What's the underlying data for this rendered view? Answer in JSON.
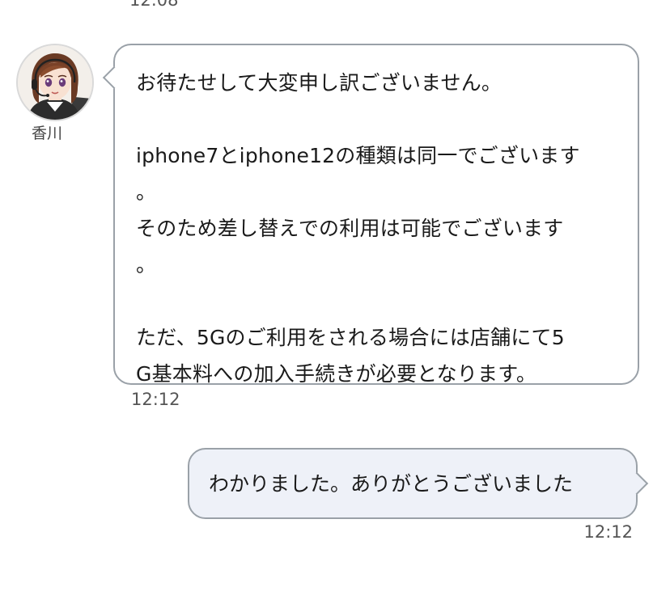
{
  "chat": {
    "top_timestamp": "12:08",
    "agent": {
      "name": "香川",
      "avatar_icon": "agent-avatar-icon",
      "message_lines": [
        "お待たせして大変申し訳ございません。",
        "",
        "iphone7とiphone12の種類は同一でございます",
        "。",
        "そのため差し替えでの利用は可能でございます",
        "。",
        "",
        "ただ、5Gのご利用をされる場合には店舗にて5",
        "G基本料への加入手続きが必要となります。"
      ],
      "timestamp": "12:12"
    },
    "user": {
      "message": "わかりました。ありがとうございました",
      "timestamp": "12:12"
    },
    "colors": {
      "bubble_border": "#9aa1a8",
      "agent_bubble_bg": "#ffffff",
      "user_bubble_bg": "#eef1f8",
      "timestamp_text": "#555555"
    }
  }
}
